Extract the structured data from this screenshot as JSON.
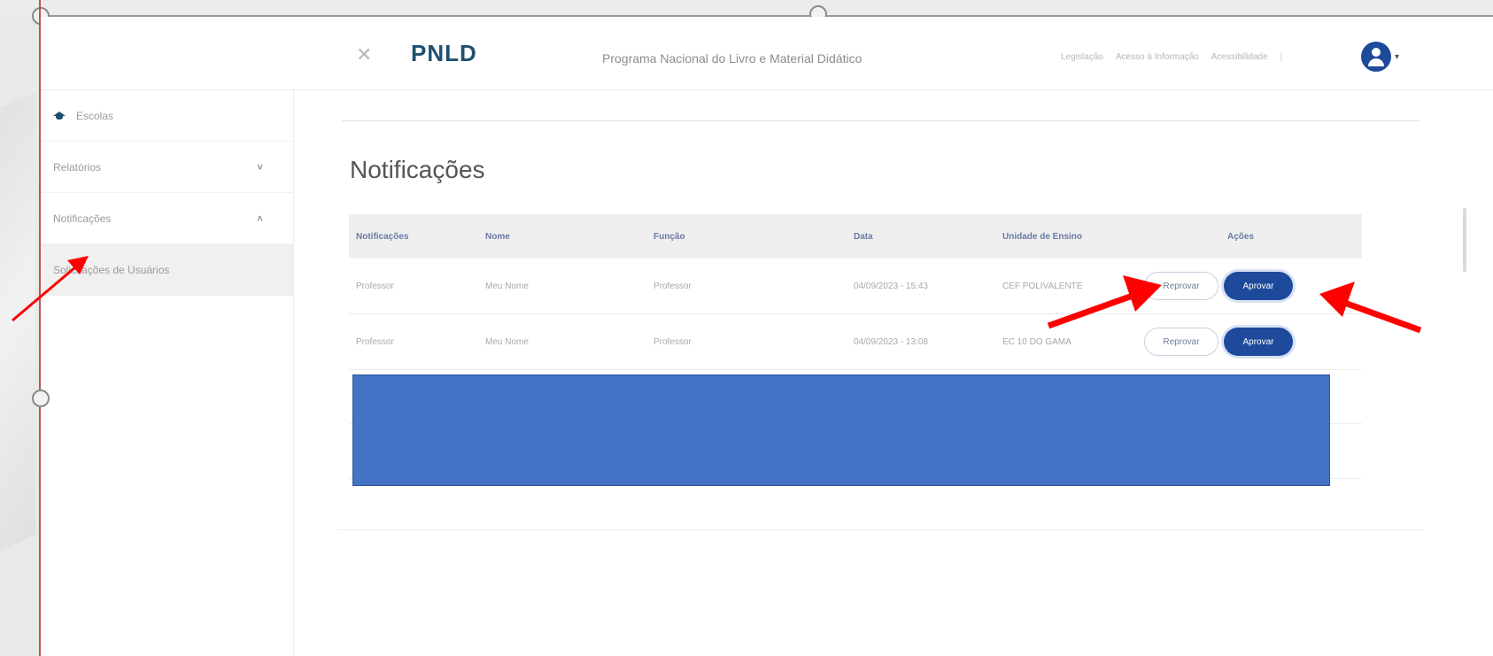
{
  "header": {
    "logo": "PNLD",
    "title": "Programa Nacional do Livro e Material Didático",
    "links": [
      "Legislação",
      "Acesso à Informação",
      "Acessibilidade"
    ],
    "separator": "|",
    "close_icon": "close-icon",
    "avatar_icon": "user-icon"
  },
  "sidebar": {
    "items": [
      {
        "label": "Escolas",
        "icon": "school-icon"
      },
      {
        "label": "Relatórios",
        "chevron": "˅"
      },
      {
        "label": "Notificações",
        "chevron": "˄"
      }
    ],
    "subitem": "Solicitações de Usuários"
  },
  "main": {
    "title": "Notificações",
    "table": {
      "headers": [
        "Notificações",
        "Nome",
        "Função",
        "Data",
        "Unidade de Ensino",
        "Ações"
      ],
      "rows": [
        {
          "notificacao": "Professor",
          "nome": "Meu Nome",
          "funcao": "Professor",
          "data": "04/09/2023 - 15:43",
          "unidade": "CEF POLIVALENTE"
        },
        {
          "notificacao": "Professor",
          "nome": "Meu Nome",
          "funcao": "Professor",
          "data": "04/09/2023 - 13:08",
          "unidade": "EC 10 DO GAMA"
        }
      ],
      "reject_label": "Reprovar",
      "approve_label": "Aprovar"
    }
  },
  "colors": {
    "brand_blue": "#1e4a9c",
    "logo_color": "#1f4f6e",
    "redaction_box": "#4472c4",
    "annotation_arrow": "#ff0000"
  }
}
